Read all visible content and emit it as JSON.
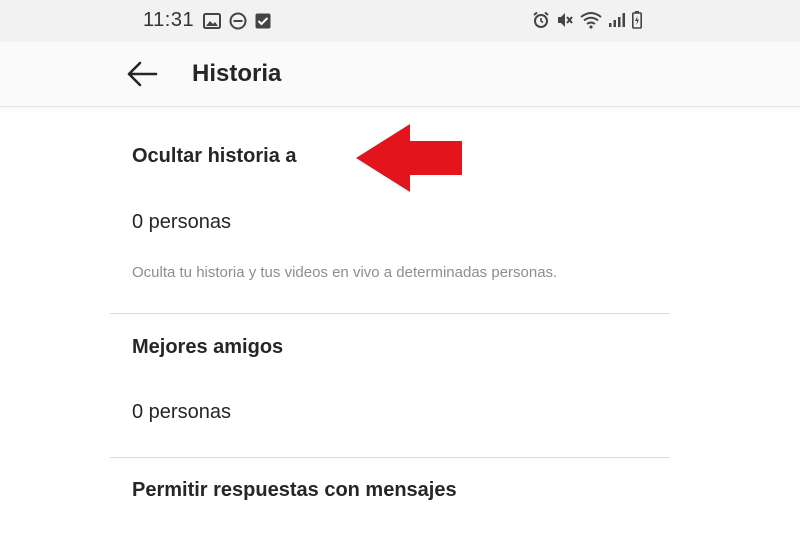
{
  "status_bar": {
    "time": "11:31",
    "left_icons": [
      "image-icon",
      "do-not-disturb-icon",
      "checkbox-icon"
    ],
    "right_icons": [
      "alarm-icon",
      "mute-icon",
      "wifi-icon",
      "signal-icon",
      "battery-icon"
    ]
  },
  "header": {
    "back_icon": "arrow-left-icon",
    "title": "Historia"
  },
  "sections": [
    {
      "title": "Ocultar historia a",
      "value": "0 personas",
      "description": "Oculta tu historia y tus videos en vivo a determinadas personas."
    },
    {
      "title": "Mejores amigos",
      "value": "0 personas"
    },
    {
      "title": "Permitir respuestas con mensajes"
    }
  ],
  "annotation": {
    "icon": "red-arrow-icon",
    "color": "#e3141b"
  },
  "colors": {
    "text_primary": "#262626",
    "text_secondary": "#8e8e8e",
    "divider": "#dbdbdb",
    "status_bar_bg": "#f2f2f2"
  }
}
